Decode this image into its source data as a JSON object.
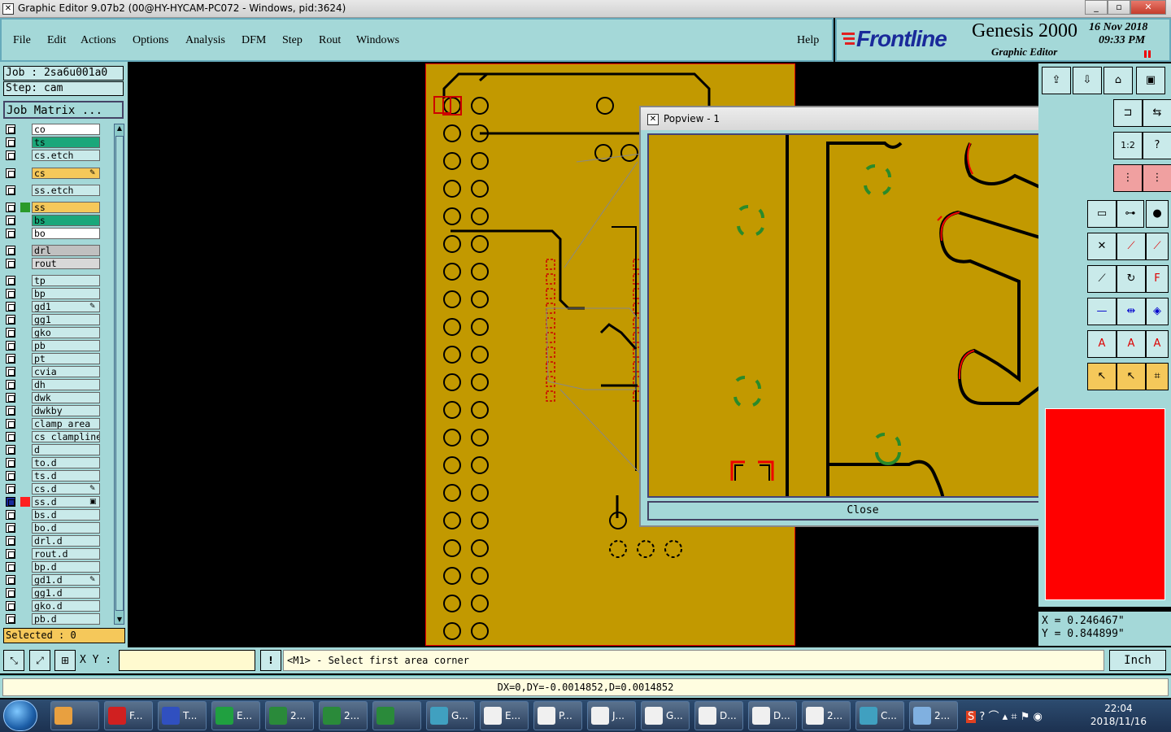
{
  "window": {
    "title": "Graphic Editor 9.07b2 (00@HY-HYCAM-PC072 - Windows, pid:3624)",
    "minimize": "_",
    "maximize": "▫",
    "close": "✕"
  },
  "menu": {
    "items": [
      "File",
      "Edit",
      "Actions",
      "Options",
      "Analysis",
      "DFM",
      "Step",
      "Rout",
      "Windows"
    ],
    "help": "Help"
  },
  "brand": {
    "logo": "Frontline",
    "product": "Genesis 2000",
    "subtitle": "Graphic Editor",
    "date": "16 Nov 2018",
    "time": "09:33 PM"
  },
  "job": {
    "job_label": "Job : 2sa6u001a0",
    "step_label": "Step: cam",
    "matrix_button": "Job Matrix ..."
  },
  "layers": [
    {
      "name": "co",
      "bg": "#ffffff",
      "swatch": "#a4d8d8"
    },
    {
      "name": "ts",
      "bg": "#1ba77a",
      "swatch": "#a4d8d8"
    },
    {
      "name": "cs.etch",
      "bg": "#c9eaea",
      "swatch": "#a4d8d8"
    },
    {
      "name": "cs",
      "bg": "#f5c85a",
      "swatch": "#a4d8d8",
      "mark": "✎"
    },
    {
      "name": "ss.etch",
      "bg": "#c9eaea",
      "swatch": "#a4d8d8"
    },
    {
      "name": "ss",
      "bg": "#f5c85a",
      "swatch": "#2a9a2a"
    },
    {
      "name": "bs",
      "bg": "#1ba77a",
      "swatch": "#a4d8d8"
    },
    {
      "name": "bo",
      "bg": "#ffffff",
      "swatch": "#a4d8d8"
    },
    {
      "name": "drl",
      "bg": "#c0c0c0",
      "swatch": "#a4d8d8"
    },
    {
      "name": "rout",
      "bg": "#d8d8d8",
      "swatch": "#a4d8d8"
    },
    {
      "name": "tp",
      "bg": "#c9eaea",
      "swatch": "#a4d8d8"
    },
    {
      "name": "bp",
      "bg": "#c9eaea",
      "swatch": "#a4d8d8"
    },
    {
      "name": "gd1",
      "bg": "#c9eaea",
      "swatch": "#a4d8d8",
      "mark": "✎"
    },
    {
      "name": "gg1",
      "bg": "#c9eaea",
      "swatch": "#a4d8d8"
    },
    {
      "name": "gko",
      "bg": "#c9eaea",
      "swatch": "#a4d8d8"
    },
    {
      "name": "pb",
      "bg": "#c9eaea",
      "swatch": "#a4d8d8"
    },
    {
      "name": "pt",
      "bg": "#c9eaea",
      "swatch": "#a4d8d8"
    },
    {
      "name": "cvia",
      "bg": "#c9eaea",
      "swatch": "#a4d8d8"
    },
    {
      "name": "dh",
      "bg": "#c9eaea",
      "swatch": "#a4d8d8"
    },
    {
      "name": "dwk",
      "bg": "#c9eaea",
      "swatch": "#a4d8d8"
    },
    {
      "name": "dwkby",
      "bg": "#c9eaea",
      "swatch": "#a4d8d8"
    },
    {
      "name": "clamp_area",
      "bg": "#c9eaea",
      "swatch": "#a4d8d8"
    },
    {
      "name": "cs_clampline",
      "bg": "#c9eaea",
      "swatch": "#a4d8d8"
    },
    {
      "name": "d",
      "bg": "#c9eaea",
      "swatch": "#a4d8d8"
    },
    {
      "name": "to.d",
      "bg": "#c9eaea",
      "swatch": "#a4d8d8"
    },
    {
      "name": "ts.d",
      "bg": "#c9eaea",
      "swatch": "#a4d8d8"
    },
    {
      "name": "cs.d",
      "bg": "#c9eaea",
      "swatch": "#a4d8d8",
      "mark": "✎"
    },
    {
      "name": "ss.d",
      "bg": "#c9eaea",
      "swatch": "#ff2020",
      "mark": "▣",
      "checked": true
    },
    {
      "name": "bs.d",
      "bg": "#c9eaea",
      "swatch": "#a4d8d8"
    },
    {
      "name": "bo.d",
      "bg": "#c9eaea",
      "swatch": "#a4d8d8"
    },
    {
      "name": "drl.d",
      "bg": "#c9eaea",
      "swatch": "#a4d8d8"
    },
    {
      "name": "rout.d",
      "bg": "#c9eaea",
      "swatch": "#a4d8d8"
    },
    {
      "name": "bp.d",
      "bg": "#c9eaea",
      "swatch": "#a4d8d8"
    },
    {
      "name": "gd1.d",
      "bg": "#c9eaea",
      "swatch": "#a4d8d8",
      "mark": "✎"
    },
    {
      "name": "gg1.d",
      "bg": "#c9eaea",
      "swatch": "#a4d8d8"
    },
    {
      "name": "gko.d",
      "bg": "#c9eaea",
      "swatch": "#a4d8d8"
    },
    {
      "name": "pb.d",
      "bg": "#c9eaea",
      "swatch": "#a4d8d8"
    }
  ],
  "selected": "Selected : 0",
  "popview": {
    "title": "Popview - 1",
    "close_x": "✕",
    "close_button": "Close"
  },
  "coords": {
    "x": "X = 0.246467\"",
    "y": "Y = 0.844899\""
  },
  "command": {
    "xy_label": "X Y :",
    "xy_value": "",
    "bang": "!",
    "prompt": "<M1> - Select first area corner",
    "unit": "Inch"
  },
  "status": "DX=0,DY=-0.0014852,D=0.0014852",
  "taskbar": {
    "items": [
      {
        "label": "",
        "icon": "shell-icon",
        "color": "#e8a040"
      },
      {
        "label": "F...",
        "icon": "frontline-icon",
        "color": "#d02020"
      },
      {
        "label": "T...",
        "icon": "floppy-icon",
        "color": "#3050c0"
      },
      {
        "label": "E...",
        "icon": "f-icon",
        "color": "#20a040"
      },
      {
        "label": "2...",
        "icon": "excel-icon",
        "color": "#2a8a3a"
      },
      {
        "label": "2...",
        "icon": "excel-icon",
        "color": "#2a8a3a"
      },
      {
        "label": "",
        "icon": "excel-icon",
        "color": "#2a8a3a"
      },
      {
        "label": "G...",
        "icon": "eye-icon",
        "color": "#40a0c0"
      },
      {
        "label": "E...",
        "icon": "x-window-icon",
        "color": "#f0f0f0"
      },
      {
        "label": "P...",
        "icon": "x-window-icon",
        "color": "#f0f0f0"
      },
      {
        "label": "J...",
        "icon": "x-window-icon",
        "color": "#f0f0f0"
      },
      {
        "label": "G...",
        "icon": "x-window-icon",
        "color": "#f0f0f0"
      },
      {
        "label": "D...",
        "icon": "x-window-icon",
        "color": "#f0f0f0"
      },
      {
        "label": "D...",
        "icon": "x-window-icon",
        "color": "#f0f0f0"
      },
      {
        "label": "2...",
        "icon": "x-window-icon",
        "color": "#f0f0f0"
      },
      {
        "label": "C...",
        "icon": "eye-icon",
        "color": "#40a0c0"
      },
      {
        "label": "2...",
        "icon": "monitor-icon",
        "color": "#80b0e0"
      }
    ],
    "time": "22:04",
    "date": "2018/11/16"
  }
}
